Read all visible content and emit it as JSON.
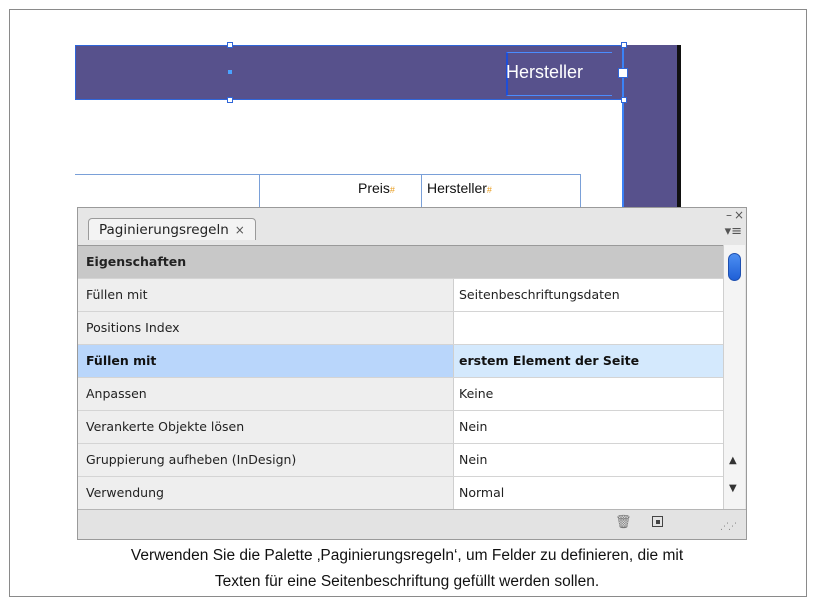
{
  "document": {
    "header_field_text": "Hersteller",
    "table_headers": [
      "Preis",
      "Hersteller"
    ]
  },
  "panel": {
    "tab_label": "Paginierungsregeln",
    "tab_close_glyph": "×",
    "minimize_glyph": "–",
    "close_glyph": "×",
    "menu_glyph": "▾≡",
    "group_label": "Eigenschaften",
    "rows": [
      {
        "label": "Füllen mit",
        "value": "Seitenbeschriftungsdaten"
      },
      {
        "label": "Positions Index",
        "value": ""
      },
      {
        "label": "Füllen mit",
        "value": "erstem Element der Seite"
      },
      {
        "label": "Anpassen",
        "value": "Keine"
      },
      {
        "label": "Verankerte Objekte lösen",
        "value": "Nein"
      },
      {
        "label": "Gruppierung aufheben (InDesign)",
        "value": "Nein"
      },
      {
        "label": "Verwendung",
        "value": "Normal"
      }
    ],
    "selected_row_index": 2,
    "icons": {
      "trash": "trash-icon",
      "new": "new-item-icon",
      "grip": "resize-grip-icon"
    }
  },
  "caption": {
    "line1": "Verwenden Sie die Palette ‚Paginierungsregeln‘, um Felder zu definieren, die mit",
    "line2": "Texten für eine Seitenbeschriftung gefüllt werden sollen."
  },
  "colors": {
    "header_bar": "#57518c",
    "selection_blue": "#b9d6fb",
    "scroll_thumb": "#2f6fe0"
  }
}
